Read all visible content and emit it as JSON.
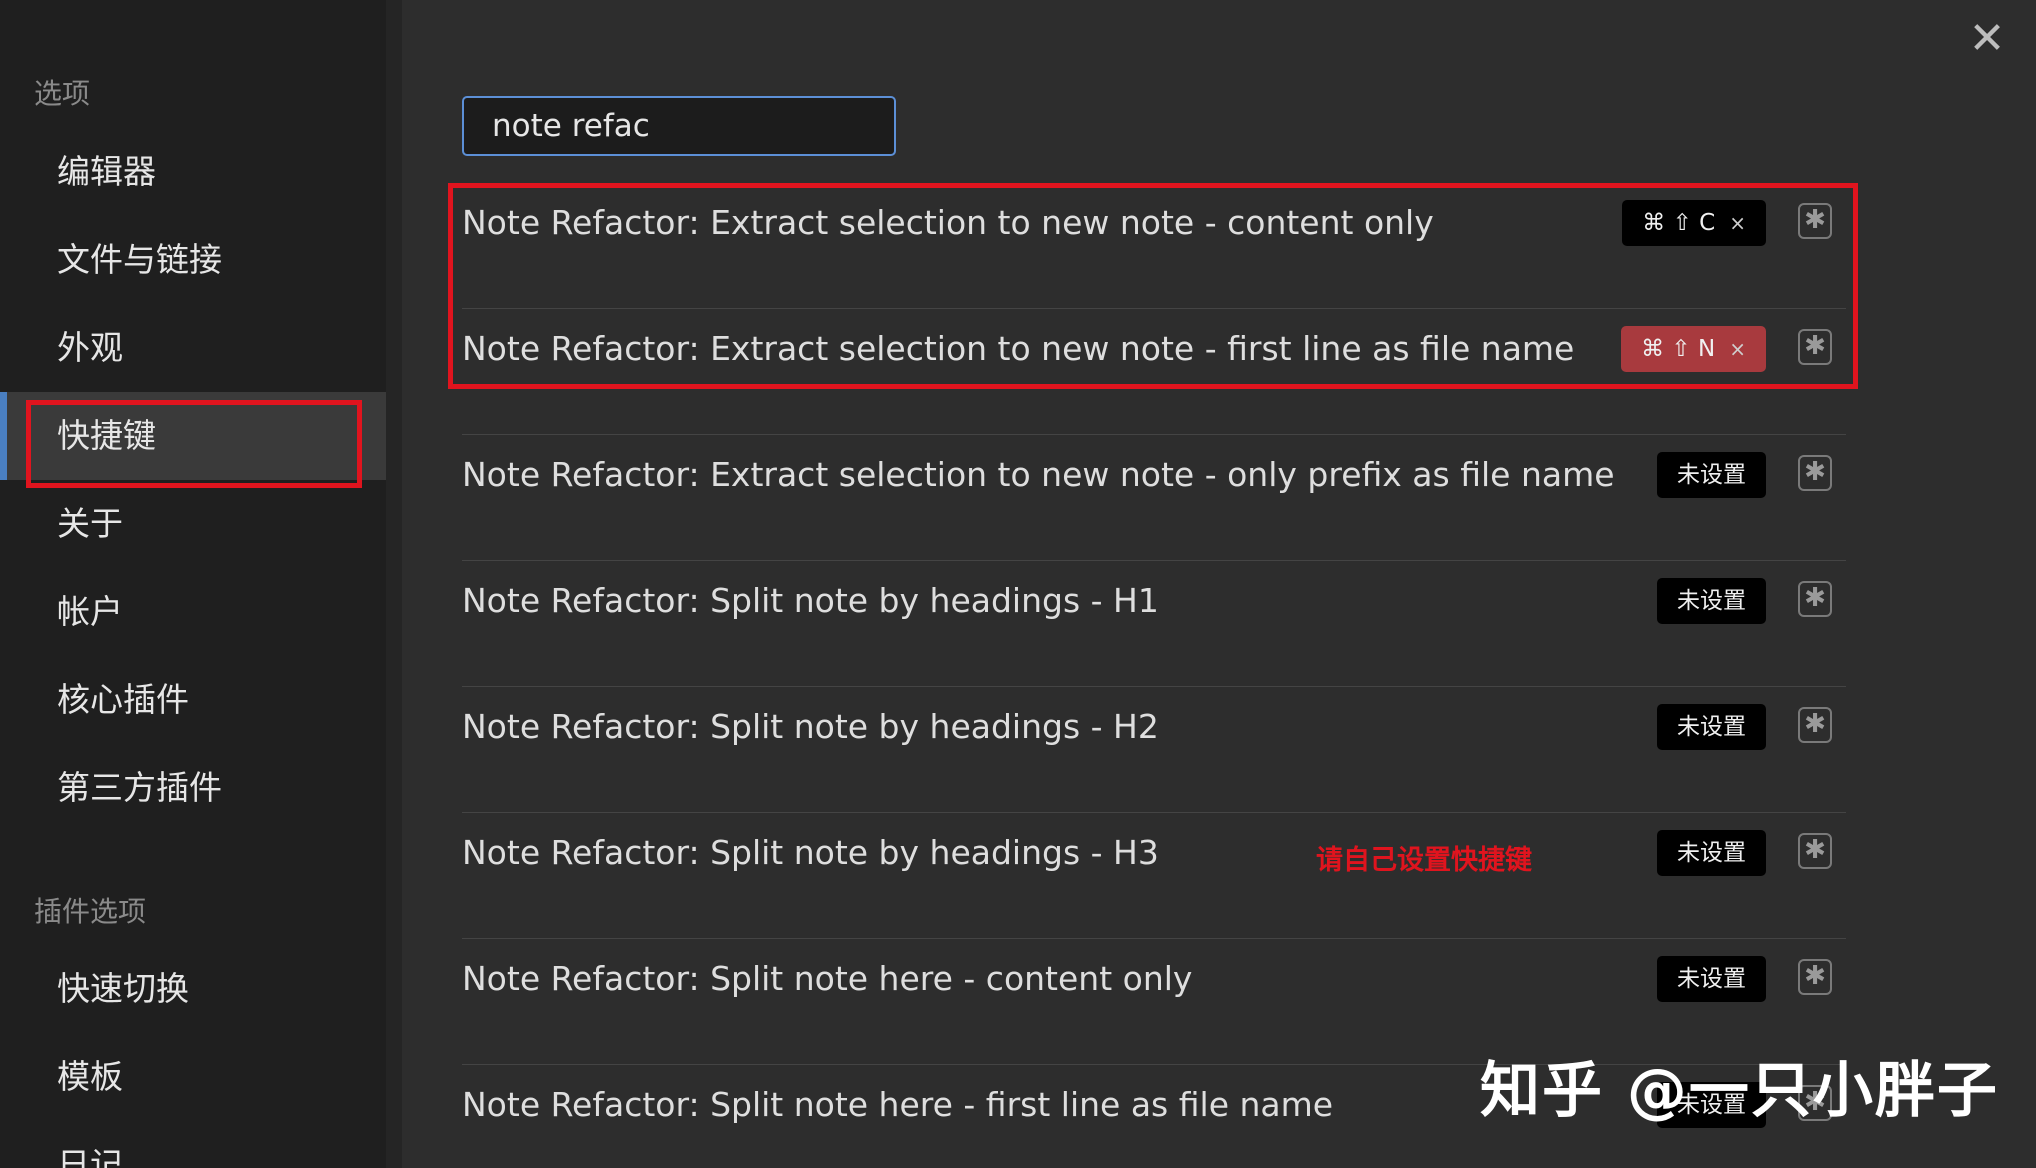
{
  "window": {
    "close_glyph": "✕"
  },
  "sidebar": {
    "options_label": "选项",
    "items": [
      {
        "label": "编辑器"
      },
      {
        "label": "文件与链接"
      },
      {
        "label": "外观"
      },
      {
        "label": "快捷键"
      },
      {
        "label": "关于"
      },
      {
        "label": "帐户"
      },
      {
        "label": "核心插件"
      },
      {
        "label": "第三方插件"
      }
    ],
    "active_item": "快捷键",
    "plugin_options_label": "插件选项",
    "plugin_items": [
      {
        "label": "快速切换"
      },
      {
        "label": "模板"
      },
      {
        "label": "日记"
      }
    ]
  },
  "search": {
    "value": "note refac"
  },
  "hotkeys": [
    {
      "name": "Note Refactor: Extract selection to new note - content only",
      "hotkey": "⌘ ⇧ C",
      "state": "set",
      "remove": "×"
    },
    {
      "name": "Note Refactor: Extract selection to new note - first line as file name",
      "hotkey": "⌘ ⇧ N",
      "state": "conflict",
      "remove": "×"
    },
    {
      "name": "Note Refactor: Extract selection to new note - only prefix as file name",
      "hotkey": "未设置",
      "state": "unset"
    },
    {
      "name": "Note Refactor: Split note by headings - H1",
      "hotkey": "未设置",
      "state": "unset"
    },
    {
      "name": "Note Refactor: Split note by headings - H2",
      "hotkey": "未设置",
      "state": "unset"
    },
    {
      "name": "Note Refactor: Split note by headings - H3",
      "hotkey": "未设置",
      "state": "unset"
    },
    {
      "name": "Note Refactor: Split note here - content only",
      "hotkey": "未设置",
      "state": "unset"
    },
    {
      "name": "Note Refactor: Split note here - first line as file name",
      "hotkey": "未设置",
      "state": "unset"
    }
  ],
  "add_hotkey_glyph": "✱",
  "annotation": "请自己设置快捷键",
  "watermark": "知乎 @一只小胖子",
  "colors": {
    "accent": "#4a7fc1",
    "highlight_red": "#e0141e",
    "conflict": "#a83a3e"
  }
}
